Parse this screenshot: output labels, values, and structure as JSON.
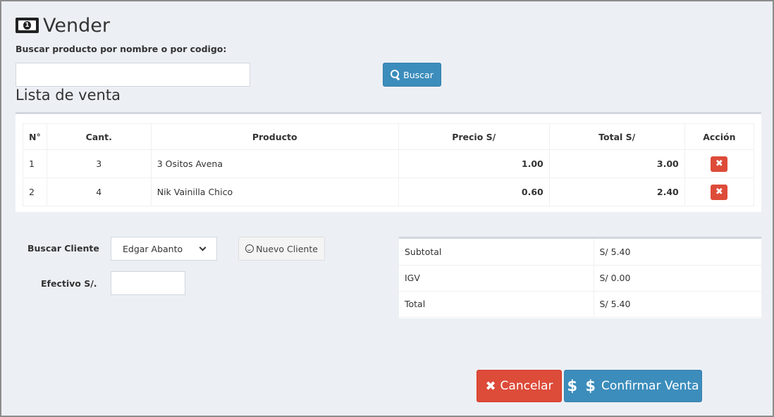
{
  "header": {
    "title": "Vender",
    "icon": "money-bill-icon"
  },
  "search": {
    "label": "Buscar producto por nombre o por codigo:",
    "value": "",
    "button_label": "Buscar"
  },
  "sale_list": {
    "title": "Lista de venta",
    "columns": [
      "N°",
      "Cant.",
      "Producto",
      "Precio S/",
      "Total S/",
      "Acción"
    ],
    "rows": [
      {
        "n": "1",
        "qty": "3",
        "product": "3 Ositos Avena",
        "price": "1.00",
        "total": "3.00"
      },
      {
        "n": "2",
        "qty": "4",
        "product": "Nik Vainilla Chico",
        "price": "0.60",
        "total": "2.40"
      }
    ]
  },
  "client": {
    "label": "Buscar Cliente",
    "selected": "Edgar Abanto",
    "new_button": "Nuevo Cliente",
    "cash_label": "Efectivo S/.",
    "cash_value": ""
  },
  "totals": {
    "rows": [
      {
        "label": "Subtotal",
        "value": "S/ 5.40"
      },
      {
        "label": "IGV",
        "value": "S/ 0.00"
      },
      {
        "label": "Total",
        "value": "S/ 5.40"
      }
    ]
  },
  "actions": {
    "cancel_label": "Cancelar",
    "confirm_label": "Confirmar Venta",
    "confirm_icon_text": "$ $",
    "cancel_icon_text": "✖"
  },
  "colors": {
    "primary": "#3c8dbc",
    "danger": "#dd4b39",
    "background": "#ecf0f5"
  }
}
